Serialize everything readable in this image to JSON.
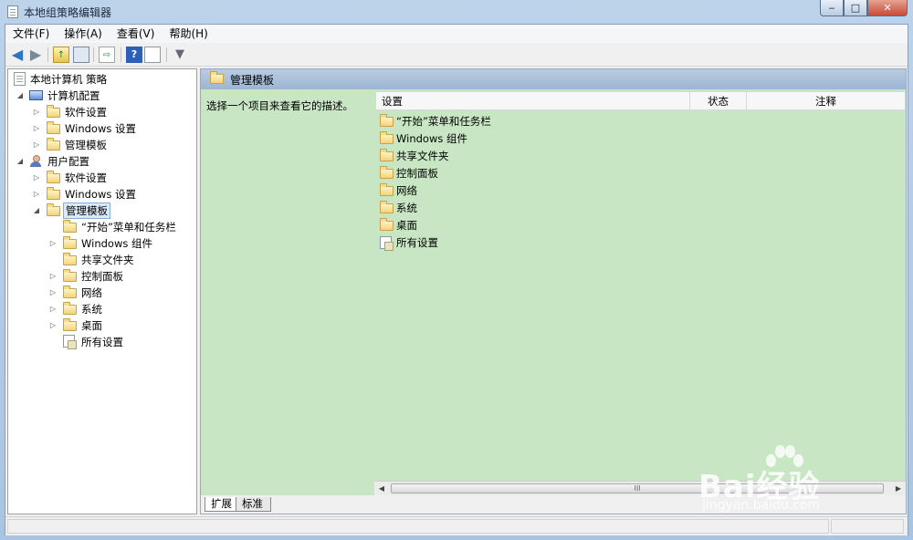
{
  "window": {
    "title": "本地组策略编辑器",
    "minimize": "‒",
    "maximize": "□",
    "close": "✕"
  },
  "menu": [
    "文件(F)",
    "操作(A)",
    "查看(V)",
    "帮助(H)"
  ],
  "toolbar": {
    "icons": [
      "back-arrow-icon",
      "forward-arrow-icon",
      "up-folder-icon",
      "show-tree-icon",
      "export-list-icon",
      "help-icon",
      "properties-icon",
      "filter-icon"
    ],
    "help_glyph": "?",
    "filter_glyph": "▼"
  },
  "tree": {
    "root": "本地计算机 策略",
    "computer_config": "计算机配置",
    "computer_children": [
      "软件设置",
      "Windows 设置",
      "管理模板"
    ],
    "user_config": "用户配置",
    "user_children": [
      "软件设置",
      "Windows 设置",
      "管理模板"
    ],
    "admin_templates_children": [
      "“开始”菜单和任务栏",
      "Windows 组件",
      "共享文件夹",
      "控制面板",
      "网络",
      "系统",
      "桌面",
      "所有设置"
    ],
    "selected": "管理模板"
  },
  "right": {
    "header_title": "管理模板",
    "description": "选择一个项目来查看它的描述。",
    "columns": [
      "设置",
      "状态",
      "注释"
    ],
    "items": [
      "“开始”菜单和任务栏",
      "Windows 组件",
      "共享文件夹",
      "控制面板",
      "网络",
      "系统",
      "桌面",
      "所有设置"
    ],
    "tabs": [
      "扩展",
      "标准"
    ],
    "active_tab": "扩展",
    "scroll_thumb_glyph": "III"
  },
  "watermark": {
    "text": "Bai经验",
    "url": "jingyan.baidu.com"
  }
}
